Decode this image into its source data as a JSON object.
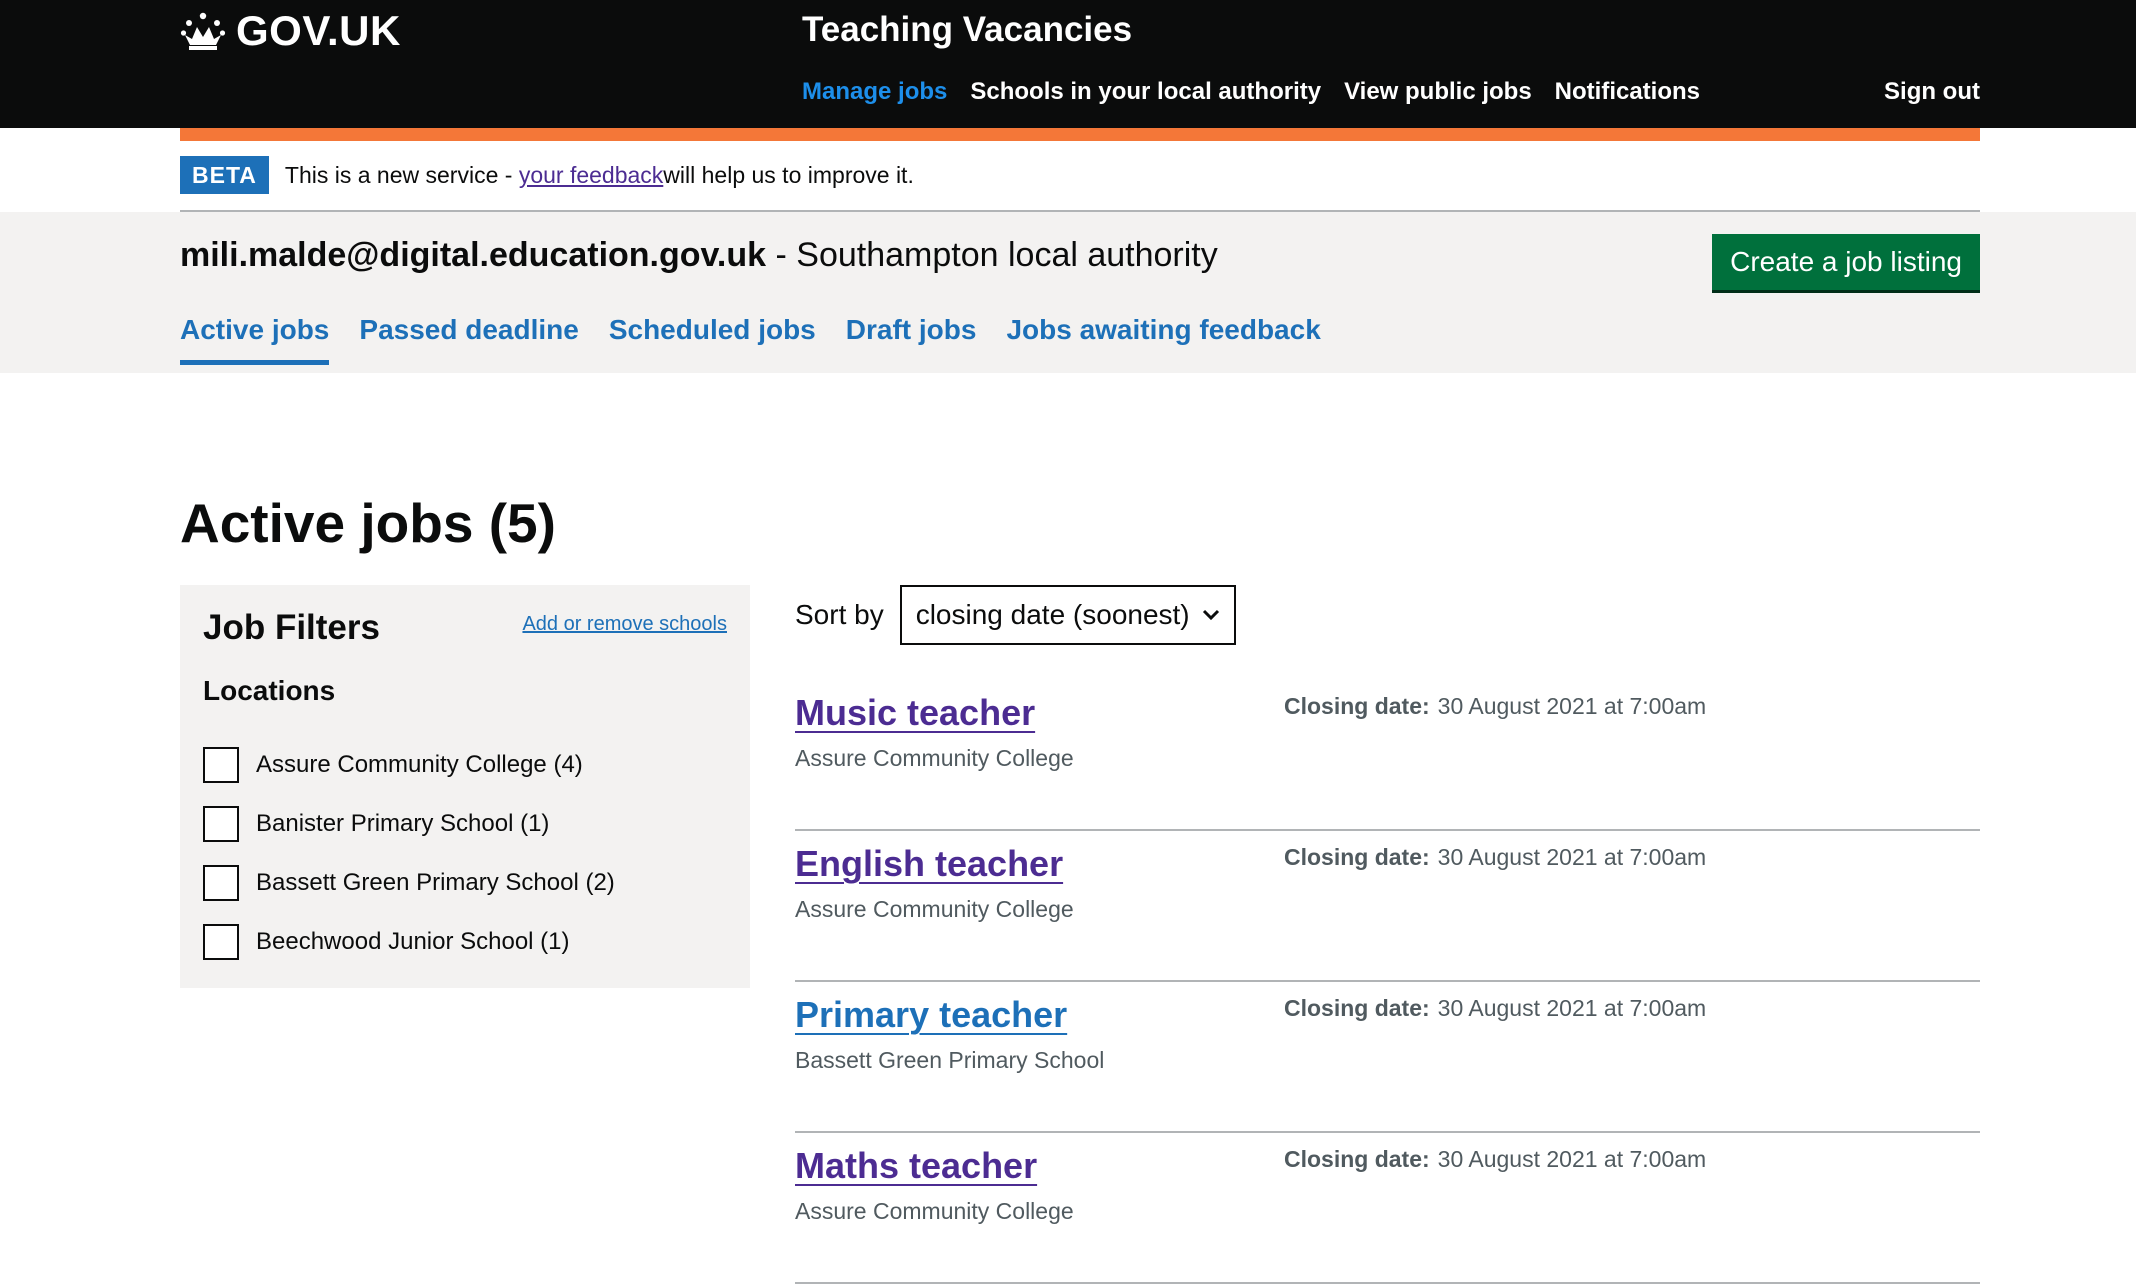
{
  "header": {
    "logo_text": "GOV.UK",
    "service_name": "Teaching Vacancies",
    "nav": [
      {
        "label": "Manage jobs",
        "active": true
      },
      {
        "label": "Schools in your local authority",
        "active": false
      },
      {
        "label": "View public jobs",
        "active": false
      },
      {
        "label": "Notifications",
        "active": false
      }
    ],
    "sign_out": "Sign out"
  },
  "beta_banner": {
    "tag": "BETA",
    "text_before": "This is a new service - ",
    "link": "your feedback",
    "text_after": " will help us to improve it."
  },
  "account": {
    "email": "mili.malde@digital.education.gov.uk",
    "organisation": " - Southampton local authority",
    "create_button": "Create a job listing"
  },
  "tabs": [
    {
      "label": "Active jobs",
      "active": true
    },
    {
      "label": "Passed deadline",
      "active": false
    },
    {
      "label": "Scheduled jobs",
      "active": false
    },
    {
      "label": "Draft jobs",
      "active": false
    },
    {
      "label": "Jobs awaiting feedback",
      "active": false
    }
  ],
  "page": {
    "title": "Active jobs",
    "count": " (5)"
  },
  "filters": {
    "heading": "Job Filters",
    "link": "Add or remove schools",
    "locations_label": "Locations",
    "locations": [
      "Assure Community College (4)",
      "Banister Primary School (1)",
      "Bassett Green Primary School (2)",
      "Beechwood Junior School (1)"
    ]
  },
  "sort": {
    "label": "Sort by",
    "selected": "closing date (soonest)"
  },
  "jobs": [
    {
      "title": "Music teacher",
      "school": "Assure Community College",
      "closing_label": "Closing date:",
      "closing_date": "30 August 2021 at 7:00am",
      "visited": true
    },
    {
      "title": "English teacher",
      "school": "Assure Community College",
      "closing_label": "Closing date:",
      "closing_date": "30 August 2021 at 7:00am",
      "visited": true
    },
    {
      "title": "Primary teacher",
      "school": "Bassett Green Primary School",
      "closing_label": "Closing date:",
      "closing_date": "30 August 2021 at 7:00am",
      "visited": false
    },
    {
      "title": "Maths teacher",
      "school": "Assure Community College",
      "closing_label": "Closing date:",
      "closing_date": "30 August 2021 at 7:00am",
      "visited": true
    }
  ],
  "colors": {
    "header_bg": "#0b0c0c",
    "orange_bar": "#f47738",
    "link_blue": "#1d70b8",
    "link_visited": "#4c2c92",
    "button_green": "#00703c",
    "panel_grey": "#f3f2f1"
  }
}
